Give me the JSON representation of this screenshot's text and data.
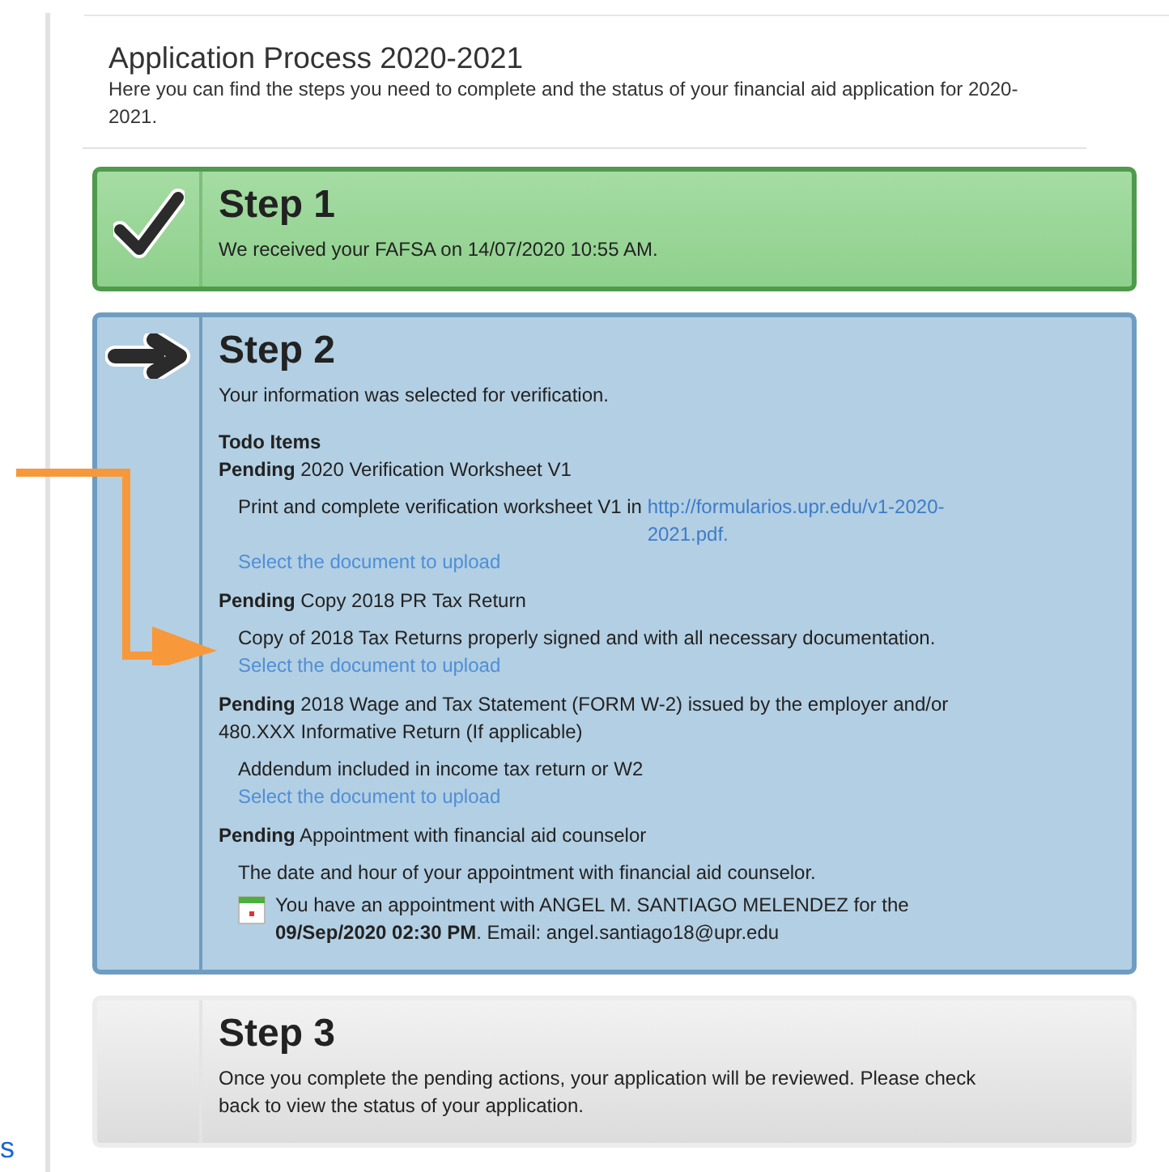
{
  "page": {
    "title": "Application Process 2020-2021",
    "intro": "Here you can find the steps you need to complete and the status of your financial aid application for 2020-2021."
  },
  "side_link_fragment": "s",
  "steps": [
    {
      "title": "Step 1",
      "kind": "done",
      "message": "We received your FAFSA on 14/07/2020 10:55 AM."
    },
    {
      "title": "Step 2",
      "kind": "current",
      "message": "Your information was selected for verification.",
      "todo_heading": "Todo Items",
      "todo_items": [
        {
          "status": "Pending",
          "name": "2020 Verification Worksheet V1",
          "description": "Print and complete verification worksheet V1 in",
          "description_link": "http://formularios.upr.edu/v1-2020-2021.pdf.",
          "upload_link": "Select the document to upload"
        },
        {
          "status": "Pending",
          "name": "Copy 2018 PR Tax Return",
          "description": "Copy of 2018 Tax Returns properly signed and with all necessary documentation.",
          "upload_link": "Select the document to upload"
        },
        {
          "status": "Pending",
          "name": "2018 Wage and Tax Statement (FORM W-2) issued by the employer and/or 480.XXX Informative Return (If applicable)",
          "description": "Addendum included in income tax return or W2",
          "upload_link": "Select the document to upload"
        },
        {
          "status": "Pending",
          "name": "Appointment with financial aid counselor",
          "description": "The date and hour of your appointment with financial aid counselor.",
          "appointment": "You have an appointment with ANGEL M. SANTIAGO MELENDEZ for the **09/Sep/2020 02:30 PM**. Email: angel.santiago18@upr.edu"
        }
      ]
    },
    {
      "title": "Step 3",
      "kind": "future",
      "message": "Once you complete the pending actions, your application will be reviewed. Please check back to view the status of your application."
    }
  ]
}
